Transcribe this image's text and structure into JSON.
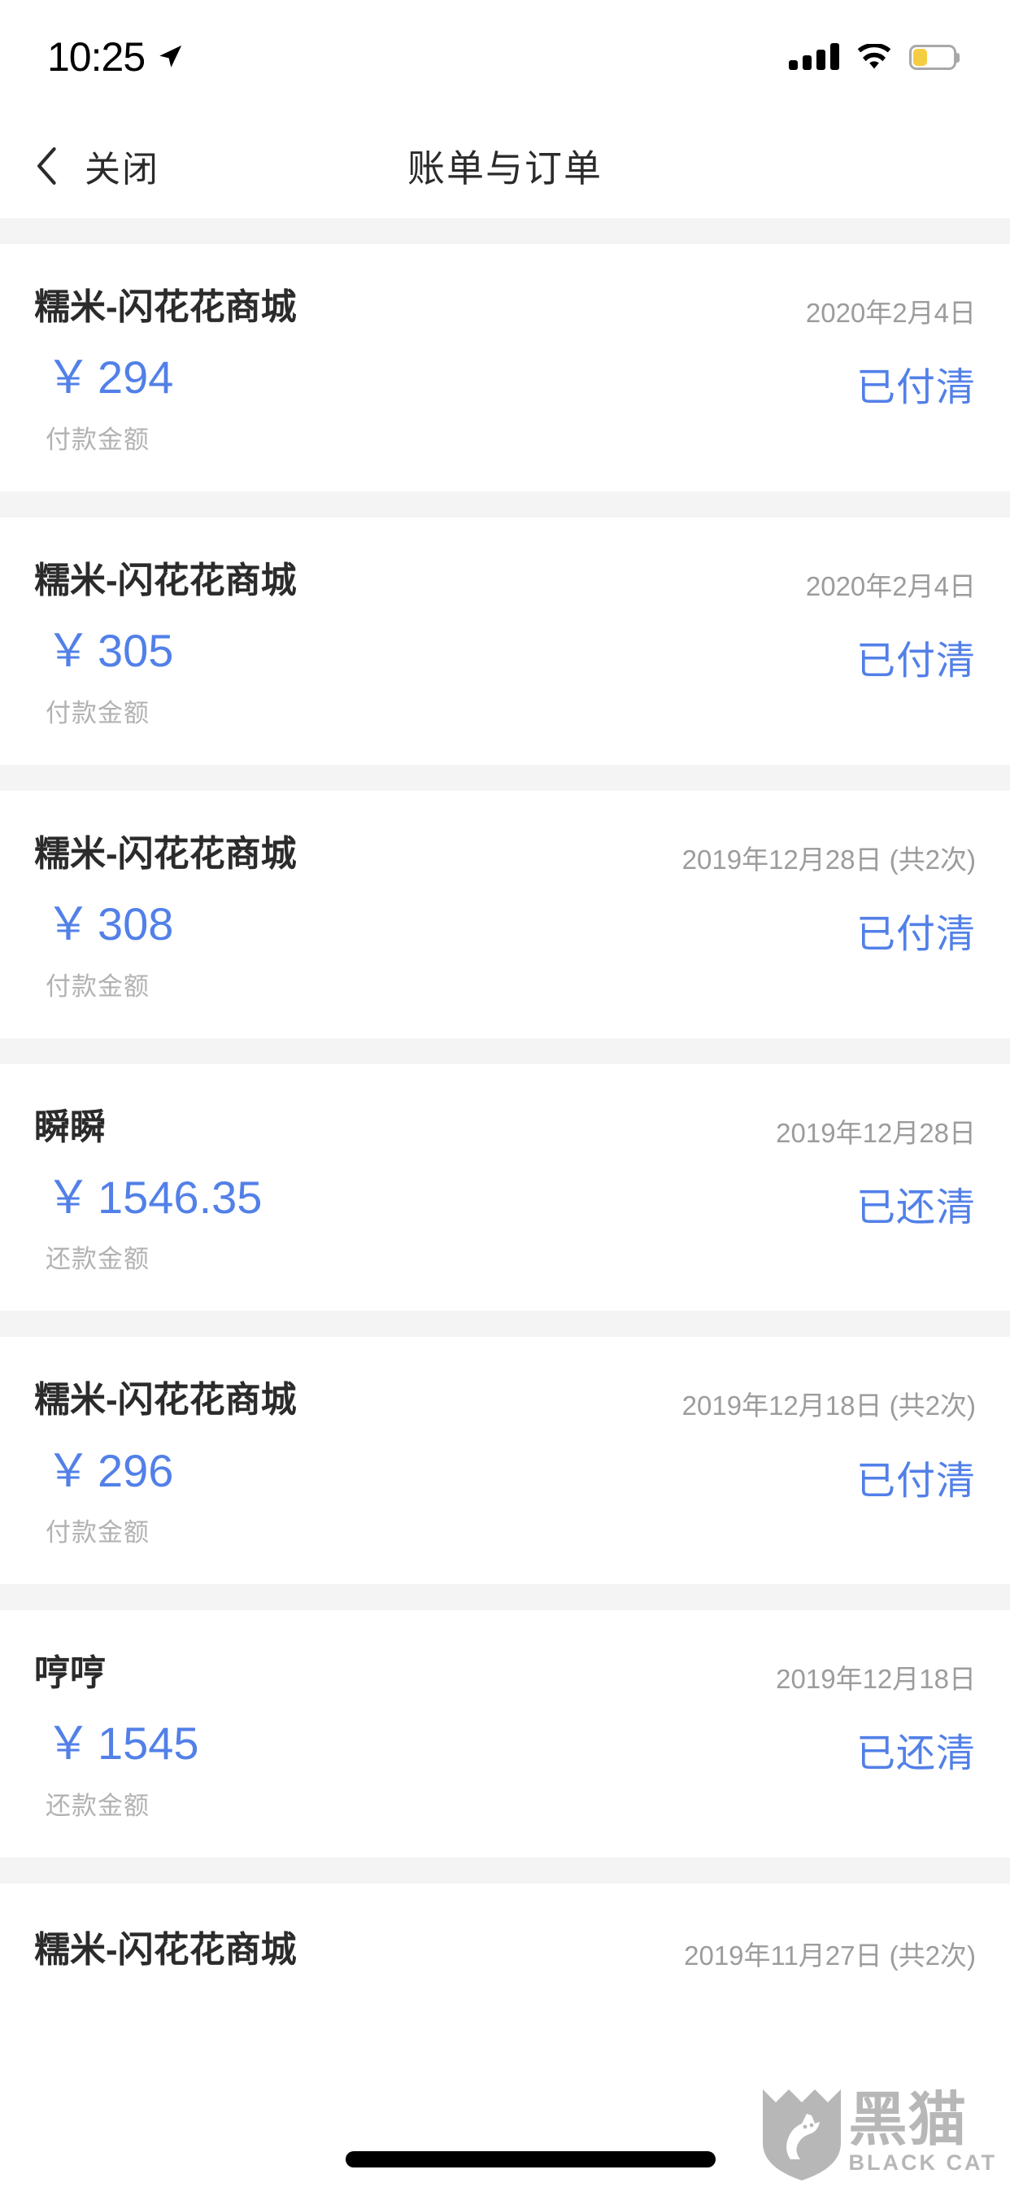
{
  "status_bar": {
    "time": "10:25",
    "location_icon": "location-arrow-icon",
    "signal_icon": "cellular-signal-icon",
    "wifi_icon": "wifi-icon",
    "battery_icon": "battery-low-power-icon"
  },
  "nav": {
    "back_icon": "chevron-left-icon",
    "close_label": "关闭",
    "title": "账单与订单"
  },
  "colors": {
    "accent_blue": "#5280e8",
    "separator_gray": "#f4f4f4",
    "primary_text": "#2b2b2b",
    "muted_text": "#9c9c9c",
    "label_text": "#b2b2b2",
    "battery_yellow": "#f5cd42"
  },
  "bills": [
    {
      "merchant": "糯米-闪花花商城",
      "date": "2020年2月4日",
      "currency": "￥",
      "amount": "294",
      "amount_label": "付款金额",
      "status": "已付清"
    },
    {
      "merchant": "糯米-闪花花商城",
      "date": "2020年2月4日",
      "currency": "￥",
      "amount": "305",
      "amount_label": "付款金额",
      "status": "已付清"
    },
    {
      "merchant": "糯米-闪花花商城",
      "date": "2019年12月28日 (共2次)",
      "currency": "￥",
      "amount": "308",
      "amount_label": "付款金额",
      "status": "已付清"
    },
    {
      "merchant": "瞬瞬",
      "date": "2019年12月28日",
      "currency": "￥",
      "amount": "1546.35",
      "amount_label": "还款金额",
      "status": "已还清"
    },
    {
      "merchant": "糯米-闪花花商城",
      "date": "2019年12月18日 (共2次)",
      "currency": "￥",
      "amount": "296",
      "amount_label": "付款金额",
      "status": "已付清"
    },
    {
      "merchant": "哼哼",
      "date": "2019年12月18日",
      "currency": "￥",
      "amount": "1545",
      "amount_label": "还款金额",
      "status": "已还清"
    }
  ],
  "partial_bill": {
    "merchant": "糯米-闪花花商城",
    "date": "2019年11月27日 (共2次)"
  },
  "watermark": {
    "icon": "black-cat-shield-icon",
    "chinese": "黑猫",
    "english": "BLACK CAT"
  }
}
